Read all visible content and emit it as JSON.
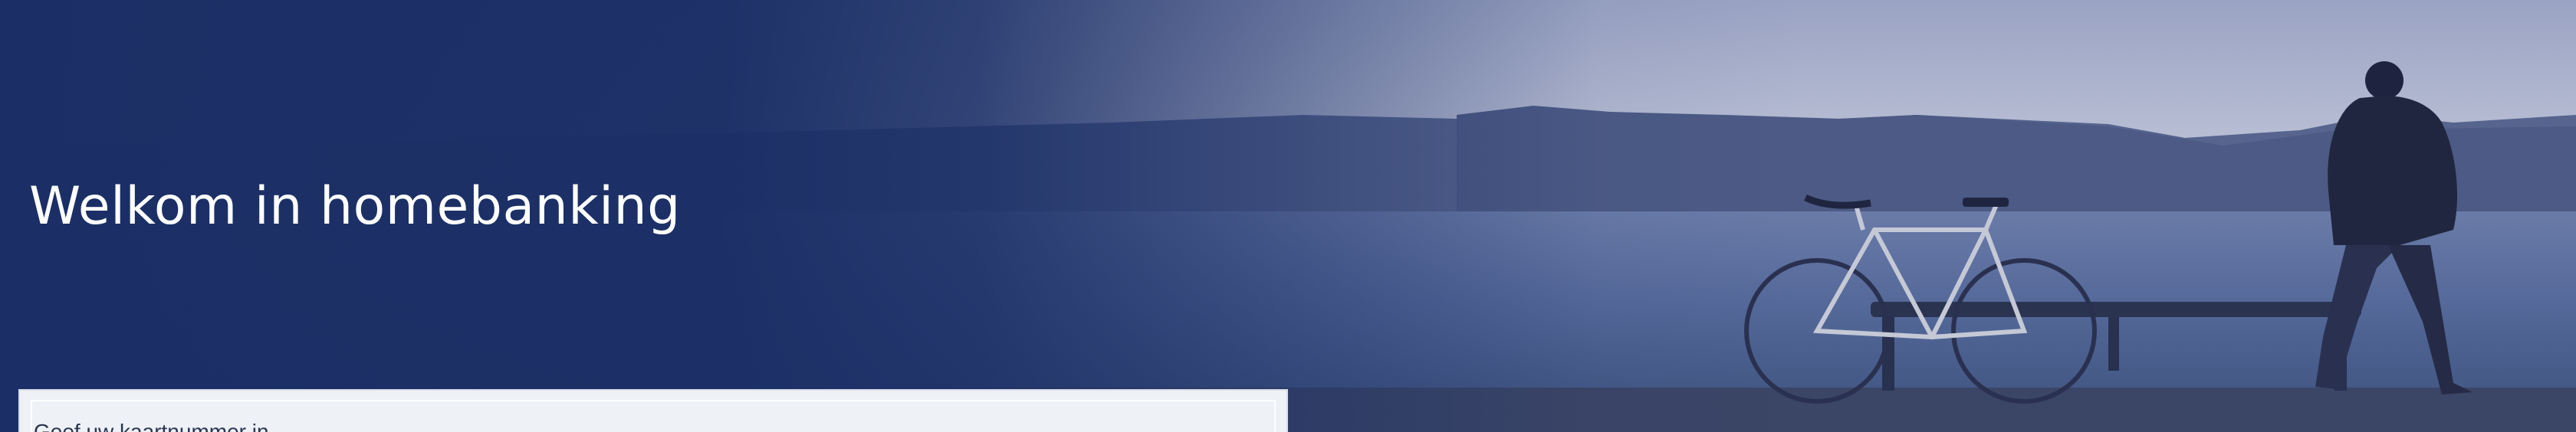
{
  "hero": {
    "title": "Welkom in homebanking",
    "background_image": "photo-man-with-bicycle-at-waterfront"
  },
  "login_panel": {
    "text": "Geef uw kaartnummer in"
  },
  "colors": {
    "brand_navy": "#1b2f66",
    "title_text": "#ffffff",
    "panel_background": "#eef1f6"
  }
}
